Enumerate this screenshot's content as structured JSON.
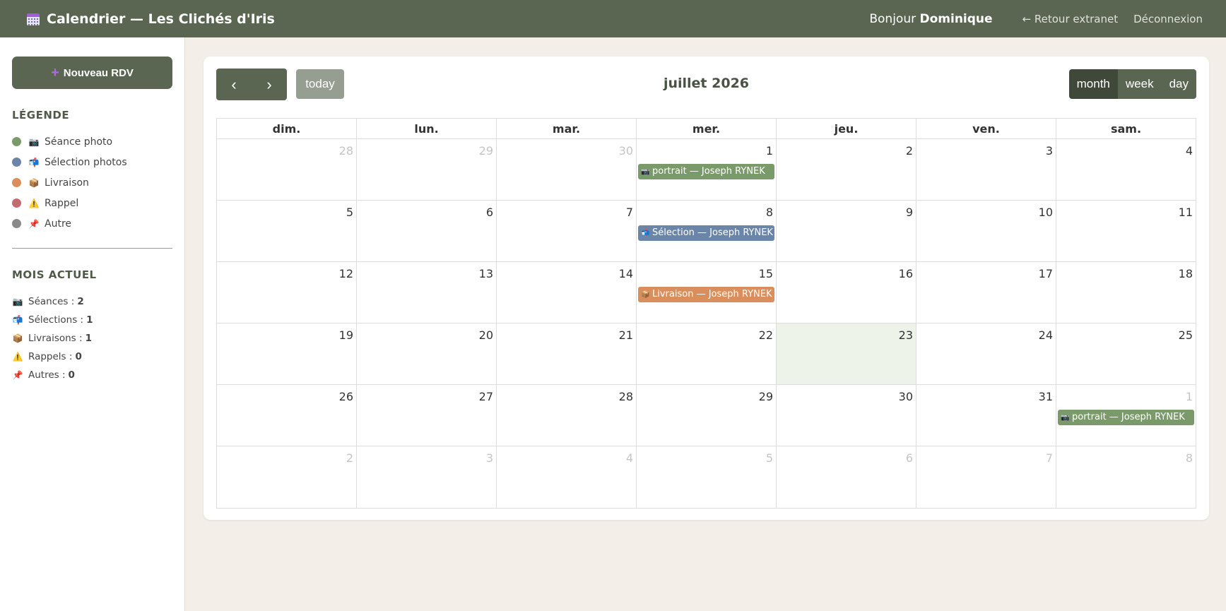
{
  "header": {
    "title": "Calendrier — Les Clichés d'Iris",
    "greeting_prefix": "Bonjour ",
    "user_name": "Dominique",
    "back_link": "← Retour extranet",
    "logout_link": "Déconnexion"
  },
  "sidebar": {
    "new_button": "Nouveau RDV",
    "legend_title": "LÉGENDE",
    "legend": [
      {
        "label": "Séance photo",
        "color": "#7a9a6a",
        "icon": "camera-icon",
        "glyph": "📷"
      },
      {
        "label": "Sélection photos",
        "color": "#6a85a8",
        "icon": "mailbox-icon",
        "glyph": "📬"
      },
      {
        "label": "Livraison",
        "color": "#d98e5c",
        "icon": "package-icon",
        "glyph": "📦"
      },
      {
        "label": "Rappel",
        "color": "#c46b72",
        "icon": "warning-icon",
        "glyph": "⚠️"
      },
      {
        "label": "Autre",
        "color": "#8a8a8a",
        "icon": "pushpin-icon",
        "glyph": "📌"
      }
    ],
    "stats_title": "MOIS ACTUEL",
    "stats": [
      {
        "label": "Séances :",
        "value": "2",
        "icon": "camera-icon",
        "glyph": "📷"
      },
      {
        "label": "Sélections :",
        "value": "1",
        "icon": "mailbox-icon",
        "glyph": "📬"
      },
      {
        "label": "Livraisons :",
        "value": "1",
        "icon": "package-icon",
        "glyph": "📦"
      },
      {
        "label": "Rappels :",
        "value": "0",
        "icon": "warning-icon",
        "glyph": "⚠️"
      },
      {
        "label": "Autres :",
        "value": "0",
        "icon": "pushpin-icon",
        "glyph": "📌"
      }
    ]
  },
  "calendar": {
    "title": "juillet 2026",
    "prev_glyph": "‹",
    "next_glyph": "›",
    "today_label": "today",
    "views": [
      {
        "label": "month",
        "active": true
      },
      {
        "label": "week",
        "active": false
      },
      {
        "label": "day",
        "active": false
      }
    ],
    "weekdays": [
      "dim.",
      "lun.",
      "mar.",
      "mer.",
      "jeu.",
      "ven.",
      "sam."
    ],
    "weeks": [
      [
        {
          "n": "28",
          "other": true
        },
        {
          "n": "29",
          "other": true
        },
        {
          "n": "30",
          "other": true
        },
        {
          "n": "1",
          "event": {
            "label": "portrait — Joseph RYNEK",
            "color": "#7a9a6a",
            "glyph": "📷"
          }
        },
        {
          "n": "2"
        },
        {
          "n": "3"
        },
        {
          "n": "4"
        }
      ],
      [
        {
          "n": "5"
        },
        {
          "n": "6"
        },
        {
          "n": "7"
        },
        {
          "n": "8",
          "event": {
            "label": "Sélection — Joseph RYNEK",
            "color": "#6a85a8",
            "glyph": "📬"
          }
        },
        {
          "n": "9"
        },
        {
          "n": "10"
        },
        {
          "n": "11"
        }
      ],
      [
        {
          "n": "12"
        },
        {
          "n": "13"
        },
        {
          "n": "14"
        },
        {
          "n": "15",
          "event": {
            "label": "Livraison — Joseph RYNEK",
            "color": "#d98e5c",
            "glyph": "📦"
          }
        },
        {
          "n": "16"
        },
        {
          "n": "17"
        },
        {
          "n": "18"
        }
      ],
      [
        {
          "n": "19"
        },
        {
          "n": "20"
        },
        {
          "n": "21"
        },
        {
          "n": "22"
        },
        {
          "n": "23",
          "today": true
        },
        {
          "n": "24"
        },
        {
          "n": "25"
        }
      ],
      [
        {
          "n": "26"
        },
        {
          "n": "27"
        },
        {
          "n": "28"
        },
        {
          "n": "29"
        },
        {
          "n": "30"
        },
        {
          "n": "31"
        },
        {
          "n": "1",
          "other": true,
          "event": {
            "label": "portrait — Joseph RYNEK",
            "color": "#7a9a6a",
            "glyph": "📷"
          }
        }
      ],
      [
        {
          "n": "2",
          "other": true
        },
        {
          "n": "3",
          "other": true
        },
        {
          "n": "4",
          "other": true
        },
        {
          "n": "5",
          "other": true
        },
        {
          "n": "6",
          "other": true
        },
        {
          "n": "7",
          "other": true
        },
        {
          "n": "8",
          "other": true
        }
      ]
    ]
  }
}
